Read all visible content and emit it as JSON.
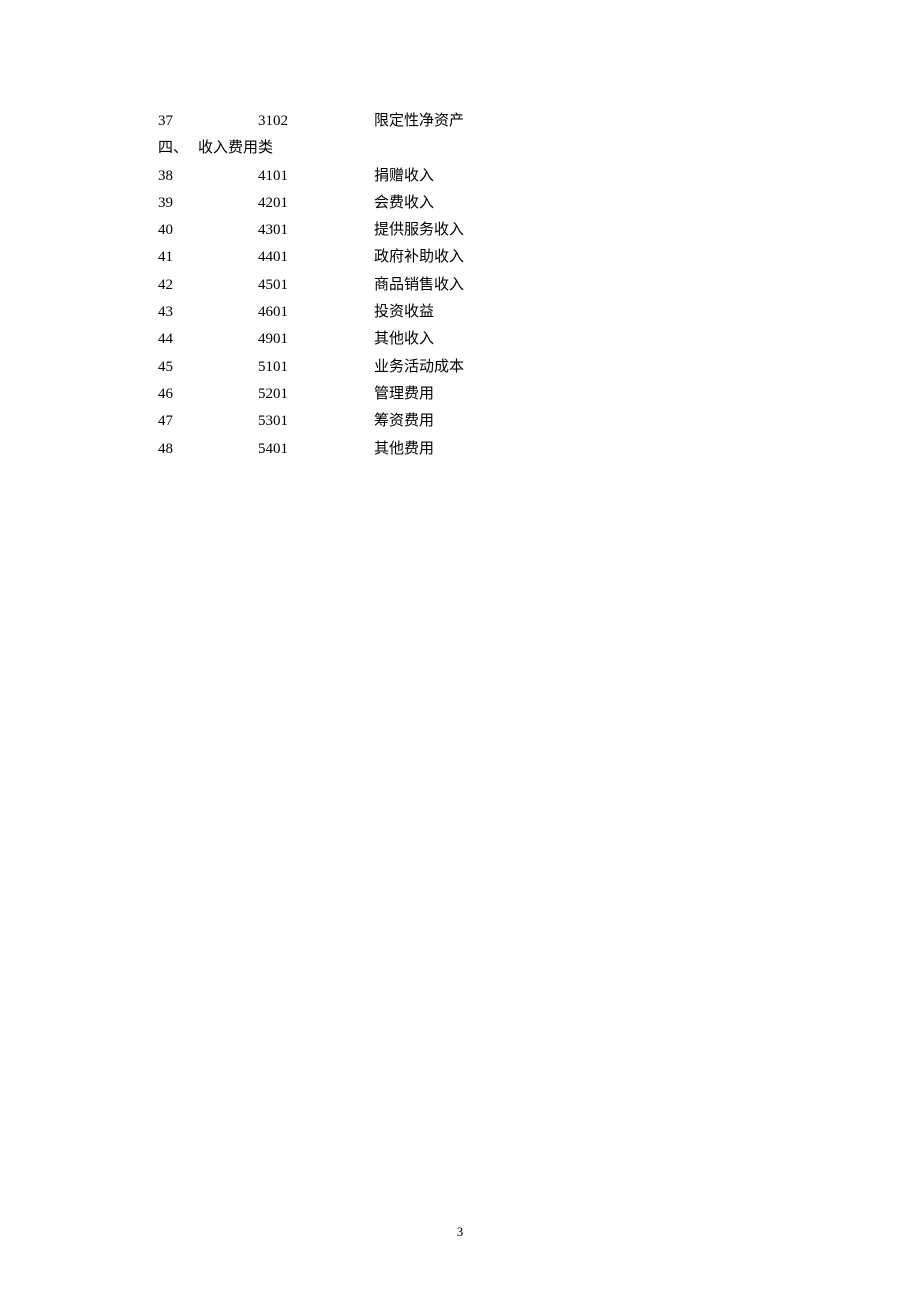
{
  "rows": [
    {
      "num": "37",
      "code": "3102",
      "name": "限定性净资产"
    }
  ],
  "section": {
    "label": "四、",
    "title": "收入费用类"
  },
  "rows2": [
    {
      "num": "38",
      "code": "4101",
      "name": "捐赠收入"
    },
    {
      "num": "39",
      "code": "4201",
      "name": "会费收入"
    },
    {
      "num": "40",
      "code": "4301",
      "name": "提供服务收入"
    },
    {
      "num": "41",
      "code": "4401",
      "name": "政府补助收入"
    },
    {
      "num": "42",
      "code": "4501",
      "name": "商品销售收入"
    },
    {
      "num": "43",
      "code": "4601",
      "name": "投资收益"
    },
    {
      "num": "44",
      "code": "4901",
      "name": "其他收入"
    },
    {
      "num": "45",
      "code": "5101",
      "name": "业务活动成本"
    },
    {
      "num": "46",
      "code": "5201",
      "name": "管理费用"
    },
    {
      "num": "47",
      "code": "5301",
      "name": "筹资费用"
    },
    {
      "num": "48",
      "code": "5401",
      "name": "其他费用"
    }
  ],
  "pageNumber": "3"
}
